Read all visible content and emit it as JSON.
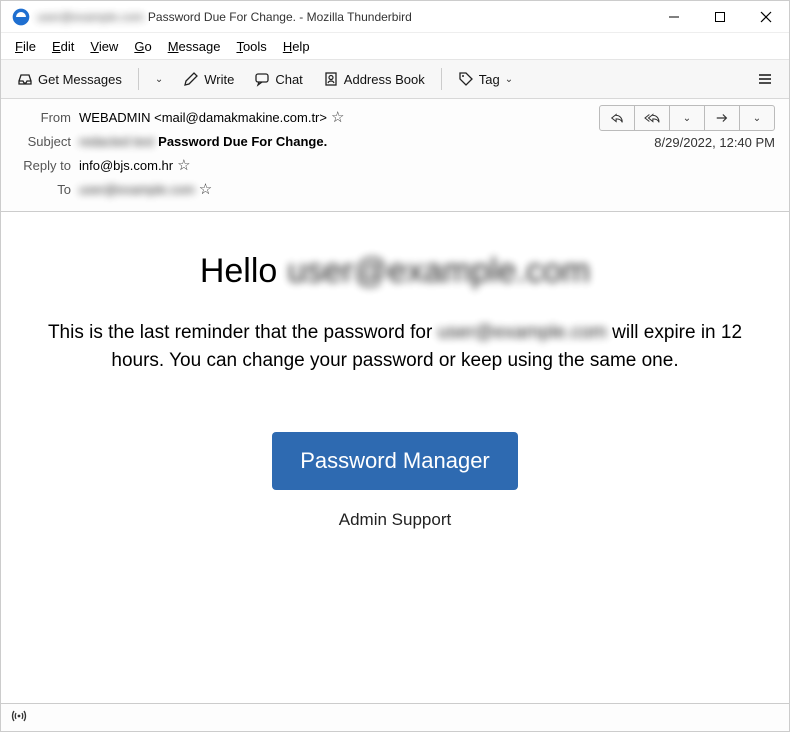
{
  "titlebar": {
    "redacted_prefix": "user@example.com",
    "title_rest": "Password Due For Change. - Mozilla Thunderbird"
  },
  "menubar": {
    "file": "File",
    "edit": "Edit",
    "view": "View",
    "go": "Go",
    "message": "Message",
    "tools": "Tools",
    "help": "Help"
  },
  "toolbar": {
    "get_messages": "Get Messages",
    "write": "Write",
    "chat": "Chat",
    "address_book": "Address Book",
    "tag": "Tag"
  },
  "headers": {
    "from_label": "From",
    "from_value": "WEBADMIN <mail@damakmakine.com.tr>",
    "subject_label": "Subject",
    "subject_redacted": "redacted text",
    "subject_rest": "Password Due For Change.",
    "reply_to_label": "Reply to",
    "reply_to_value": "info@bjs.com.hr",
    "to_label": "To",
    "to_redacted": "user@example.com",
    "datetime": "8/29/2022, 12:40 PM"
  },
  "body": {
    "hello": "Hello",
    "hello_redacted": "user@example.com",
    "text_before": "This is the last reminder that the password for",
    "text_redacted": "user@example.com",
    "text_after": "will expire in 12 hours. You can change your password or keep using the same one.",
    "button": "Password Manager",
    "admin_support": "Admin Support"
  }
}
